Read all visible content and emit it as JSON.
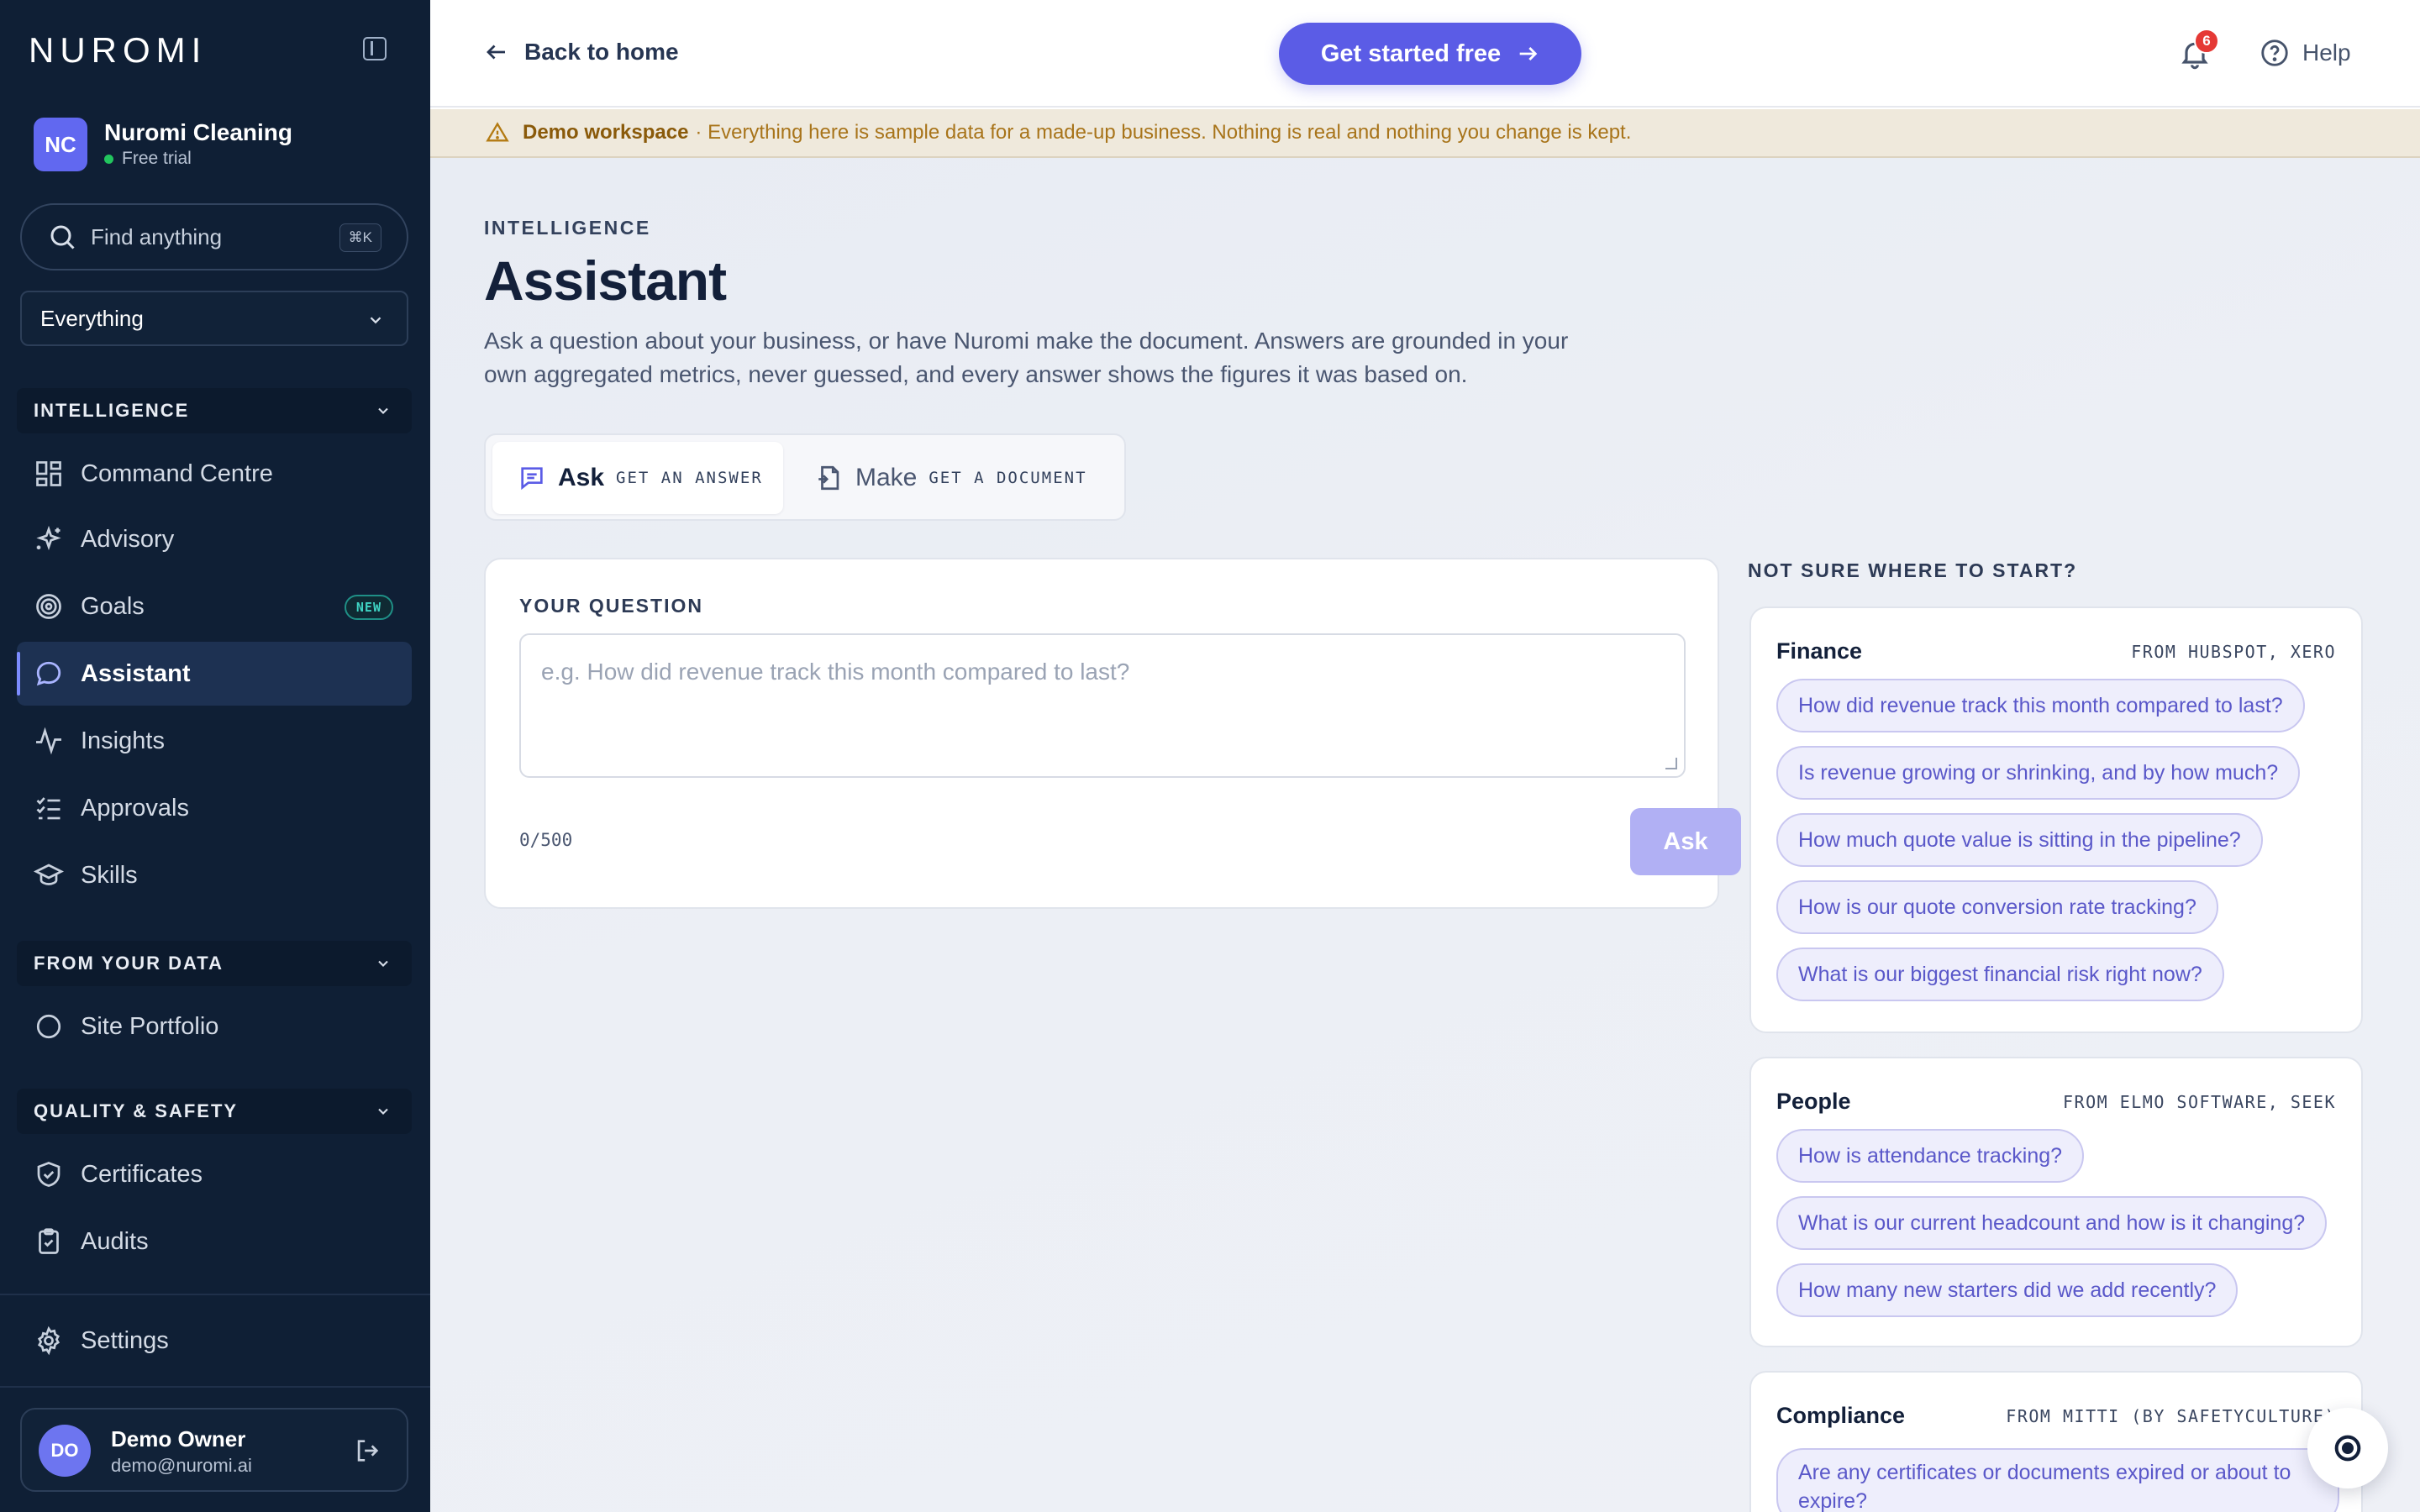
{
  "app": {
    "logo_text": "NUROMI"
  },
  "workspace": {
    "initials": "NC",
    "name": "Nuromi Cleaning",
    "plan": "Free trial"
  },
  "search": {
    "placeholder": "Find anything",
    "shortcut": "⌘K"
  },
  "scope": {
    "selected": "Everything"
  },
  "sidebar": {
    "sections": [
      {
        "title": "INTELLIGENCE",
        "items": [
          {
            "label": "Command Centre",
            "icon": "grid-icon"
          },
          {
            "label": "Advisory",
            "icon": "sparkles-icon"
          },
          {
            "label": "Goals",
            "icon": "target-icon",
            "badge": "NEW"
          },
          {
            "label": "Assistant",
            "icon": "chat-icon",
            "active": true
          },
          {
            "label": "Insights",
            "icon": "pulse-icon"
          },
          {
            "label": "Approvals",
            "icon": "checklist-icon"
          },
          {
            "label": "Skills",
            "icon": "graduation-cap-icon"
          }
        ]
      },
      {
        "title": "FROM YOUR DATA",
        "items": [
          {
            "label": "Site Portfolio",
            "icon": "circle-icon"
          }
        ]
      },
      {
        "title": "QUALITY & SAFETY",
        "items": [
          {
            "label": "Certificates",
            "icon": "shield-check-icon"
          },
          {
            "label": "Audits",
            "icon": "clipboard-check-icon"
          }
        ]
      }
    ],
    "settings_label": "Settings"
  },
  "user": {
    "initials": "DO",
    "name": "Demo Owner",
    "email": "demo@nuromi.ai"
  },
  "topbar": {
    "back_label": "Back to home",
    "cta_label": "Get started free",
    "notification_count": "6",
    "help_label": "Help"
  },
  "banner": {
    "title": "Demo workspace",
    "text": "· Everything here is sample data for a made-up business. Nothing is real and nothing you change is kept."
  },
  "page": {
    "eyebrow": "INTELLIGENCE",
    "title": "Assistant",
    "description": "Ask a question about your business, or have Nuromi make the document. Answers are grounded in your own aggregated metrics, never guessed, and every answer shows the figures it was based on."
  },
  "modes": [
    {
      "label": "Ask",
      "sub": "GET AN ANSWER",
      "active": true
    },
    {
      "label": "Make",
      "sub": "GET A DOCUMENT",
      "active": false
    }
  ],
  "question": {
    "label": "YOUR QUESTION",
    "placeholder": "e.g. How did revenue track this month compared to last?",
    "counter": "0/500",
    "ask_label": "Ask"
  },
  "suggestions": {
    "title": "NOT SURE WHERE TO START?",
    "groups": [
      {
        "title": "Finance",
        "source": "FROM HUBSPOT, XERO",
        "questions": [
          "How did revenue track this month compared to last?",
          "Is revenue growing or shrinking, and by how much?",
          "How much quote value is sitting in the pipeline?",
          "How is our quote conversion rate tracking?",
          "What is our biggest financial risk right now?"
        ]
      },
      {
        "title": "People",
        "source": "FROM ELMO SOFTWARE, SEEK",
        "questions": [
          "How is attendance tracking?",
          "What is our current headcount and how is it changing?",
          "How many new starters did we add recently?"
        ]
      },
      {
        "title": "Compliance",
        "source": "FROM MITTI (BY SAFETYCULTURE)",
        "questions": [
          "Are any certificates or documents expired or about to expire?"
        ]
      }
    ]
  },
  "colors": {
    "sidebar_bg": "#0f1f35",
    "accent": "#5b5ce6",
    "chip_bg": "#eeeefc",
    "badge_red": "#e53935"
  }
}
